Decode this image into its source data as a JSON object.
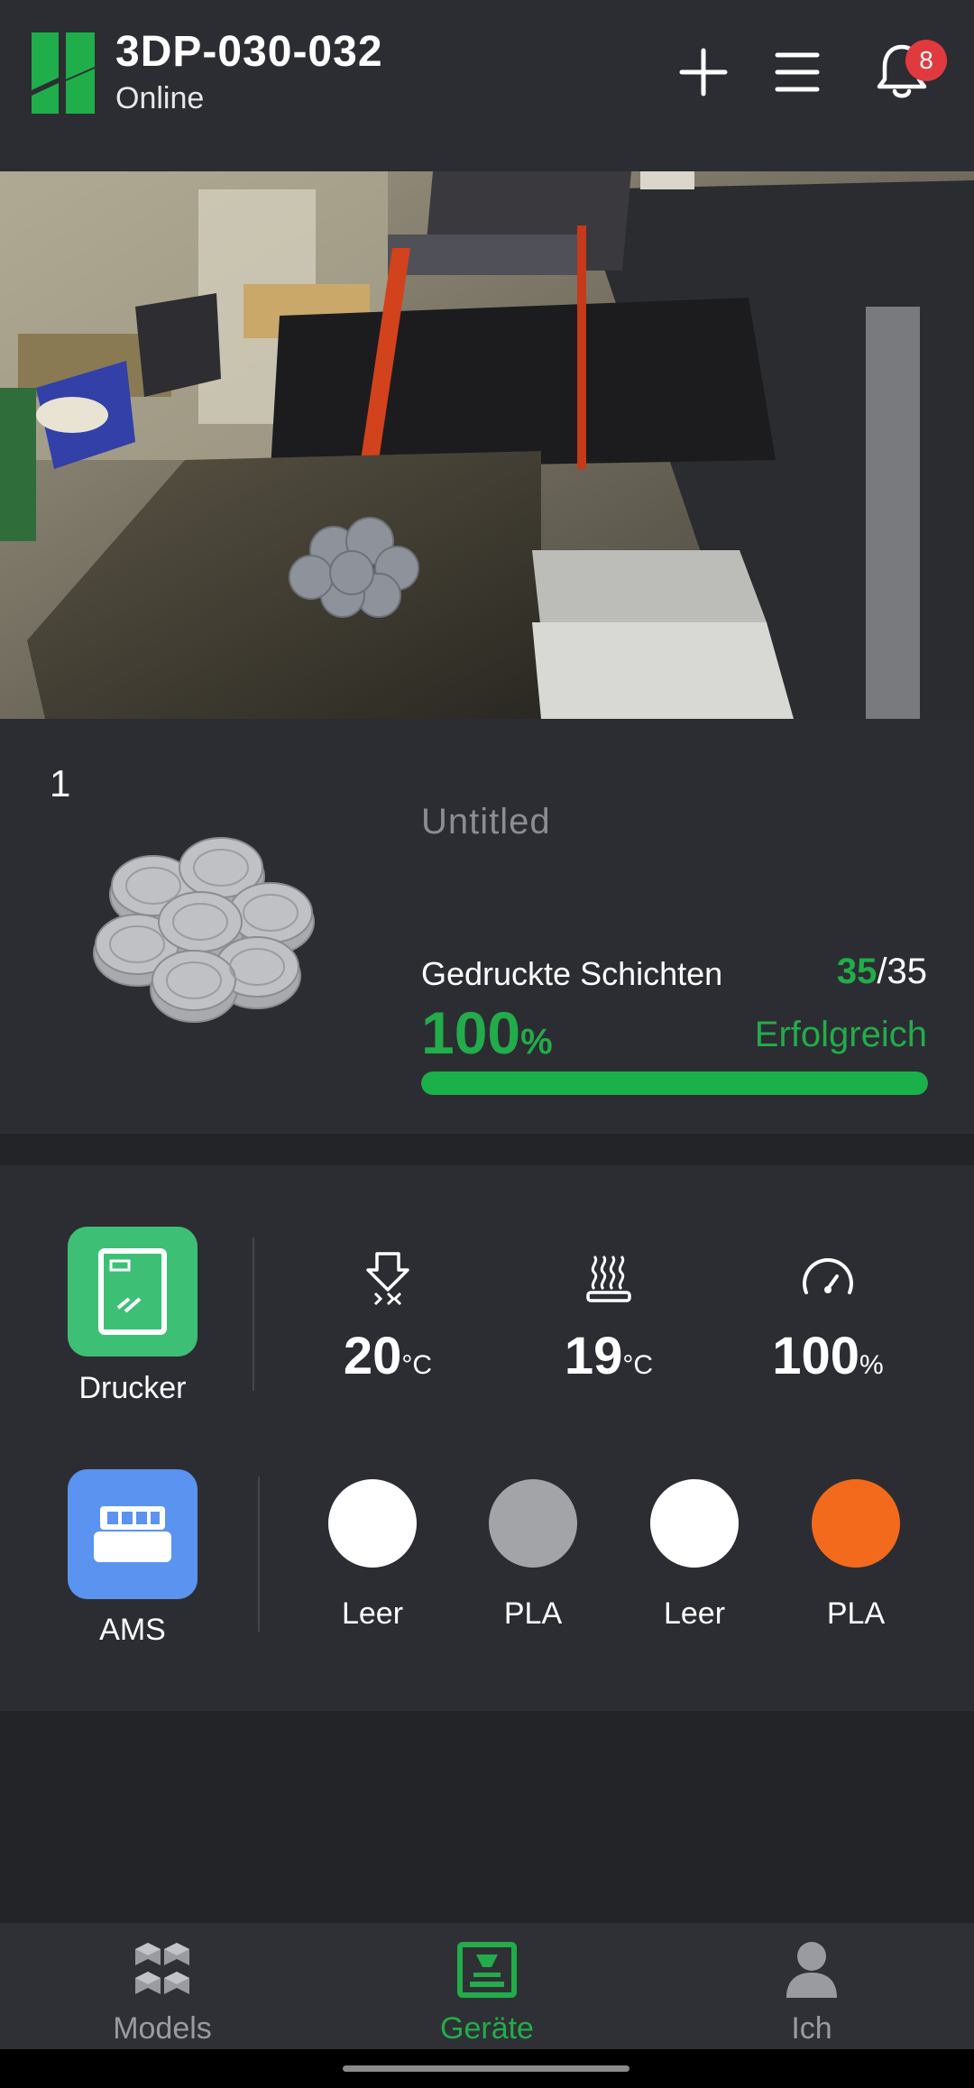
{
  "header": {
    "title": "3DP-030-032",
    "status": "Online",
    "notification_count": "8",
    "icons": [
      "add-icon",
      "menu-icon",
      "bell-icon"
    ]
  },
  "job": {
    "plate_number": "1",
    "name": "Untitled",
    "layers_label": "Gedruckte Schichten",
    "layers_current": "35",
    "layers_total": "/35",
    "progress_value": "100",
    "progress_unit": "%",
    "progress_fraction": 1.0,
    "status": "Erfolgreich"
  },
  "printer": {
    "label": "Drucker",
    "nozzle_temp": "20",
    "bed_temp": "19",
    "temp_unit": "°C",
    "speed": "100",
    "speed_unit": "%"
  },
  "ams": {
    "label": "AMS",
    "slots": [
      {
        "label": "Leer",
        "color": "#ffffff"
      },
      {
        "label": "PLA",
        "color": "#a3a4a8"
      },
      {
        "label": "Leer",
        "color": "#ffffff"
      },
      {
        "label": "PLA",
        "color": "#f36a1c"
      }
    ]
  },
  "nav": {
    "items": [
      {
        "label": "Models",
        "icon": "cubes-icon"
      },
      {
        "label": "Geräte",
        "icon": "printer-icon"
      },
      {
        "label": "Ich",
        "icon": "person-icon"
      }
    ],
    "active": "Geräte"
  },
  "colors": {
    "accent": "#22ac4a",
    "printer_button": "#3ebf76",
    "ams_button": "#5a93f0",
    "badge": "#e0393e"
  }
}
